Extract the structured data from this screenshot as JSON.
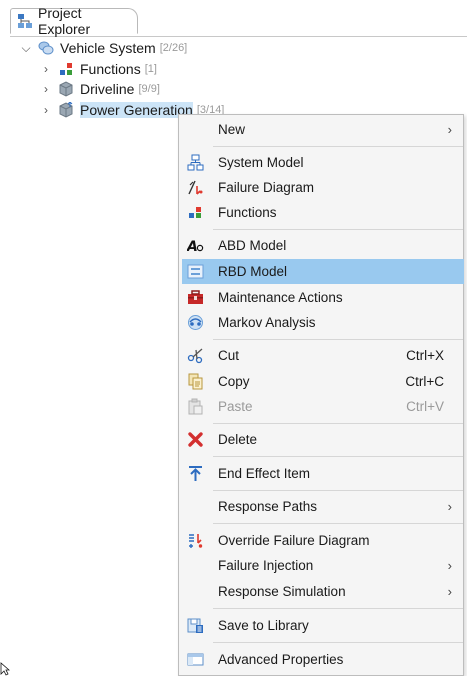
{
  "explorer": {
    "tab_title": "Project Explorer",
    "tree": [
      {
        "label": "Vehicle System",
        "count": "[2/26]",
        "icon": "system-icon",
        "expanded": true
      },
      {
        "label": "Functions",
        "count": "[1]",
        "icon": "functions-icon"
      },
      {
        "label": "Driveline",
        "count": "[9/9]",
        "icon": "component-icon"
      },
      {
        "label": "Power Generation",
        "count": "[3/14]",
        "icon": "component-icon"
      }
    ]
  },
  "menu": {
    "items": [
      {
        "label": "New",
        "submenu": true
      },
      {
        "label": "System Model",
        "icon": "system-model-icon"
      },
      {
        "label": "Failure Diagram",
        "icon": "failure-diagram-icon"
      },
      {
        "label": "Functions",
        "icon": "functions-icon"
      },
      {
        "label": "ABD Model",
        "icon": "abd-model-icon"
      },
      {
        "label": "RBD Model",
        "icon": "rbd-model-icon",
        "highlighted": true
      },
      {
        "label": "Maintenance Actions",
        "icon": "toolbox-icon"
      },
      {
        "label": "Markov Analysis",
        "icon": "markov-icon"
      },
      {
        "label": "Cut",
        "shortcut": "Ctrl+X",
        "icon": "cut-icon"
      },
      {
        "label": "Copy",
        "shortcut": "Ctrl+C",
        "icon": "copy-icon"
      },
      {
        "label": "Paste",
        "shortcut": "Ctrl+V",
        "icon": "paste-icon",
        "disabled": true
      },
      {
        "label": "Delete",
        "icon": "delete-icon"
      },
      {
        "label": "End Effect Item",
        "icon": "end-effect-icon"
      },
      {
        "label": "Response Paths",
        "submenu": true
      },
      {
        "label": "Override Failure Diagram",
        "icon": "override-icon"
      },
      {
        "label": "Failure Injection",
        "submenu": true
      },
      {
        "label": "Response Simulation",
        "submenu": true
      },
      {
        "label": "Save to Library",
        "icon": "library-icon"
      },
      {
        "label": "Advanced Properties",
        "icon": "properties-icon"
      }
    ]
  }
}
